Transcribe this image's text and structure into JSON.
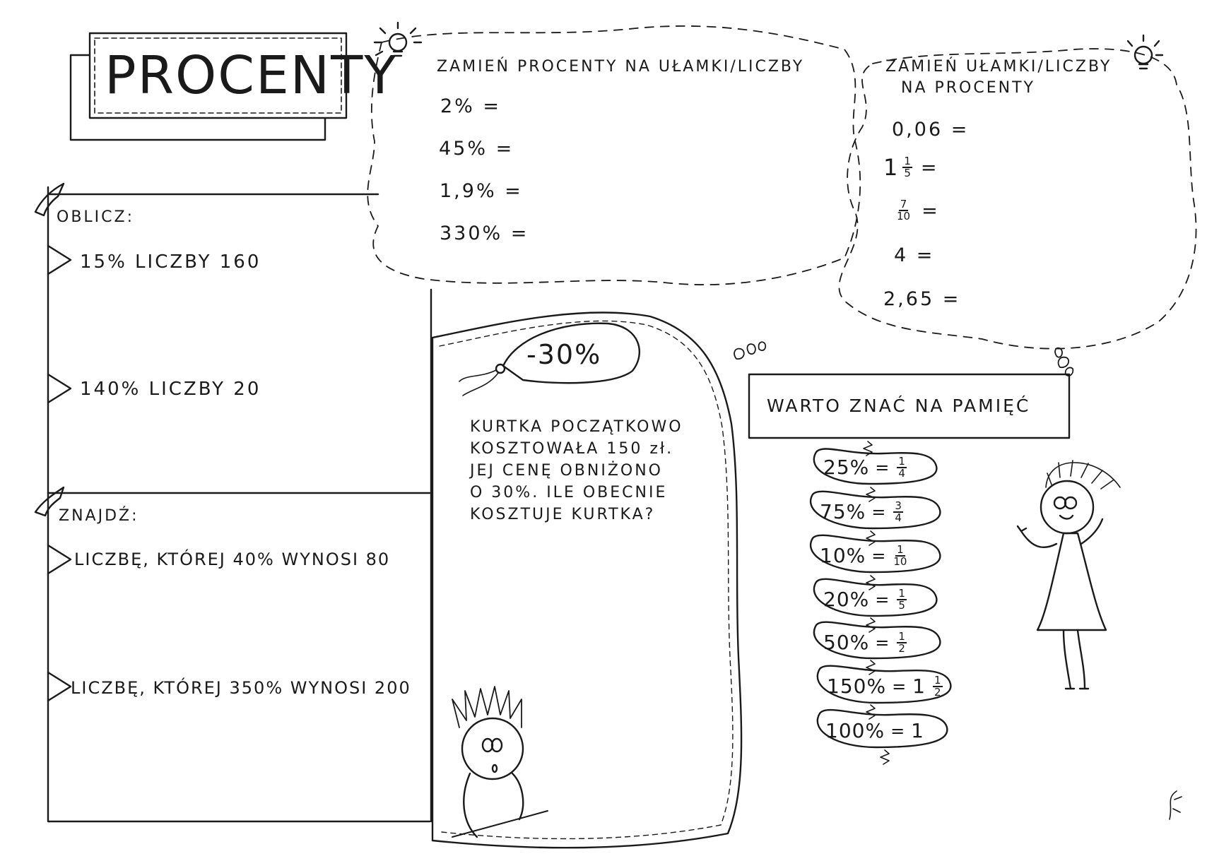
{
  "title": "PROCENTY",
  "percent_to_fraction": {
    "heading": "ZAMIEŃ PROCENTY NA UŁAMKI/LICZBY",
    "items": [
      "2% =",
      "45% =",
      "1,9% =",
      "330% ="
    ]
  },
  "fraction_to_percent": {
    "heading_line1": "ZAMIEŃ UŁAMKI/LICZBY",
    "heading_line2": "NA PROCENTY",
    "item1": "0,06 =",
    "item2": {
      "whole": "1",
      "num": "1",
      "den": "5",
      "eq": "="
    },
    "item3": {
      "num": "7",
      "den": "10",
      "eq": "="
    },
    "item4": "4 =",
    "item5": "2,65 ="
  },
  "calculate": {
    "heading": "OBLICZ:",
    "items": [
      "15% LICZBY 160",
      "140% LICZBY 20"
    ]
  },
  "find": {
    "heading": "ZNAJDŹ:",
    "items": [
      "LICZBĘ, KTÓREJ 40% WYNOSI 80",
      "LICZBĘ, KTÓREJ 350% WYNOSI 200"
    ]
  },
  "jacket_problem": {
    "tag": "-30%",
    "lines": [
      "KURTKA POCZĄTKOWO",
      "KOSZTOWAŁA 150 zł.",
      "JEJ CENĘ OBNIŻONO",
      "O 30%. ILE OBECNIE",
      "KOSZTUJE KURTKA?"
    ]
  },
  "memorize": {
    "heading": "WARTO ZNAĆ NA PAMIĘĆ",
    "items": [
      {
        "pct": "25%",
        "eq": "=",
        "whole": "",
        "num": "1",
        "den": "4"
      },
      {
        "pct": "75%",
        "eq": "=",
        "whole": "",
        "num": "3",
        "den": "4"
      },
      {
        "pct": "10%",
        "eq": "=",
        "whole": "",
        "num": "1",
        "den": "10"
      },
      {
        "pct": "20%",
        "eq": "=",
        "whole": "",
        "num": "1",
        "den": "5"
      },
      {
        "pct": "50%",
        "eq": "=",
        "whole": "",
        "num": "1",
        "den": "2"
      },
      {
        "pct": "150%",
        "eq": "=",
        "whole": "1",
        "num": "1",
        "den": "2"
      },
      {
        "pct": "100%",
        "eq": "=",
        "whole": "1",
        "num": "",
        "den": ""
      }
    ]
  }
}
